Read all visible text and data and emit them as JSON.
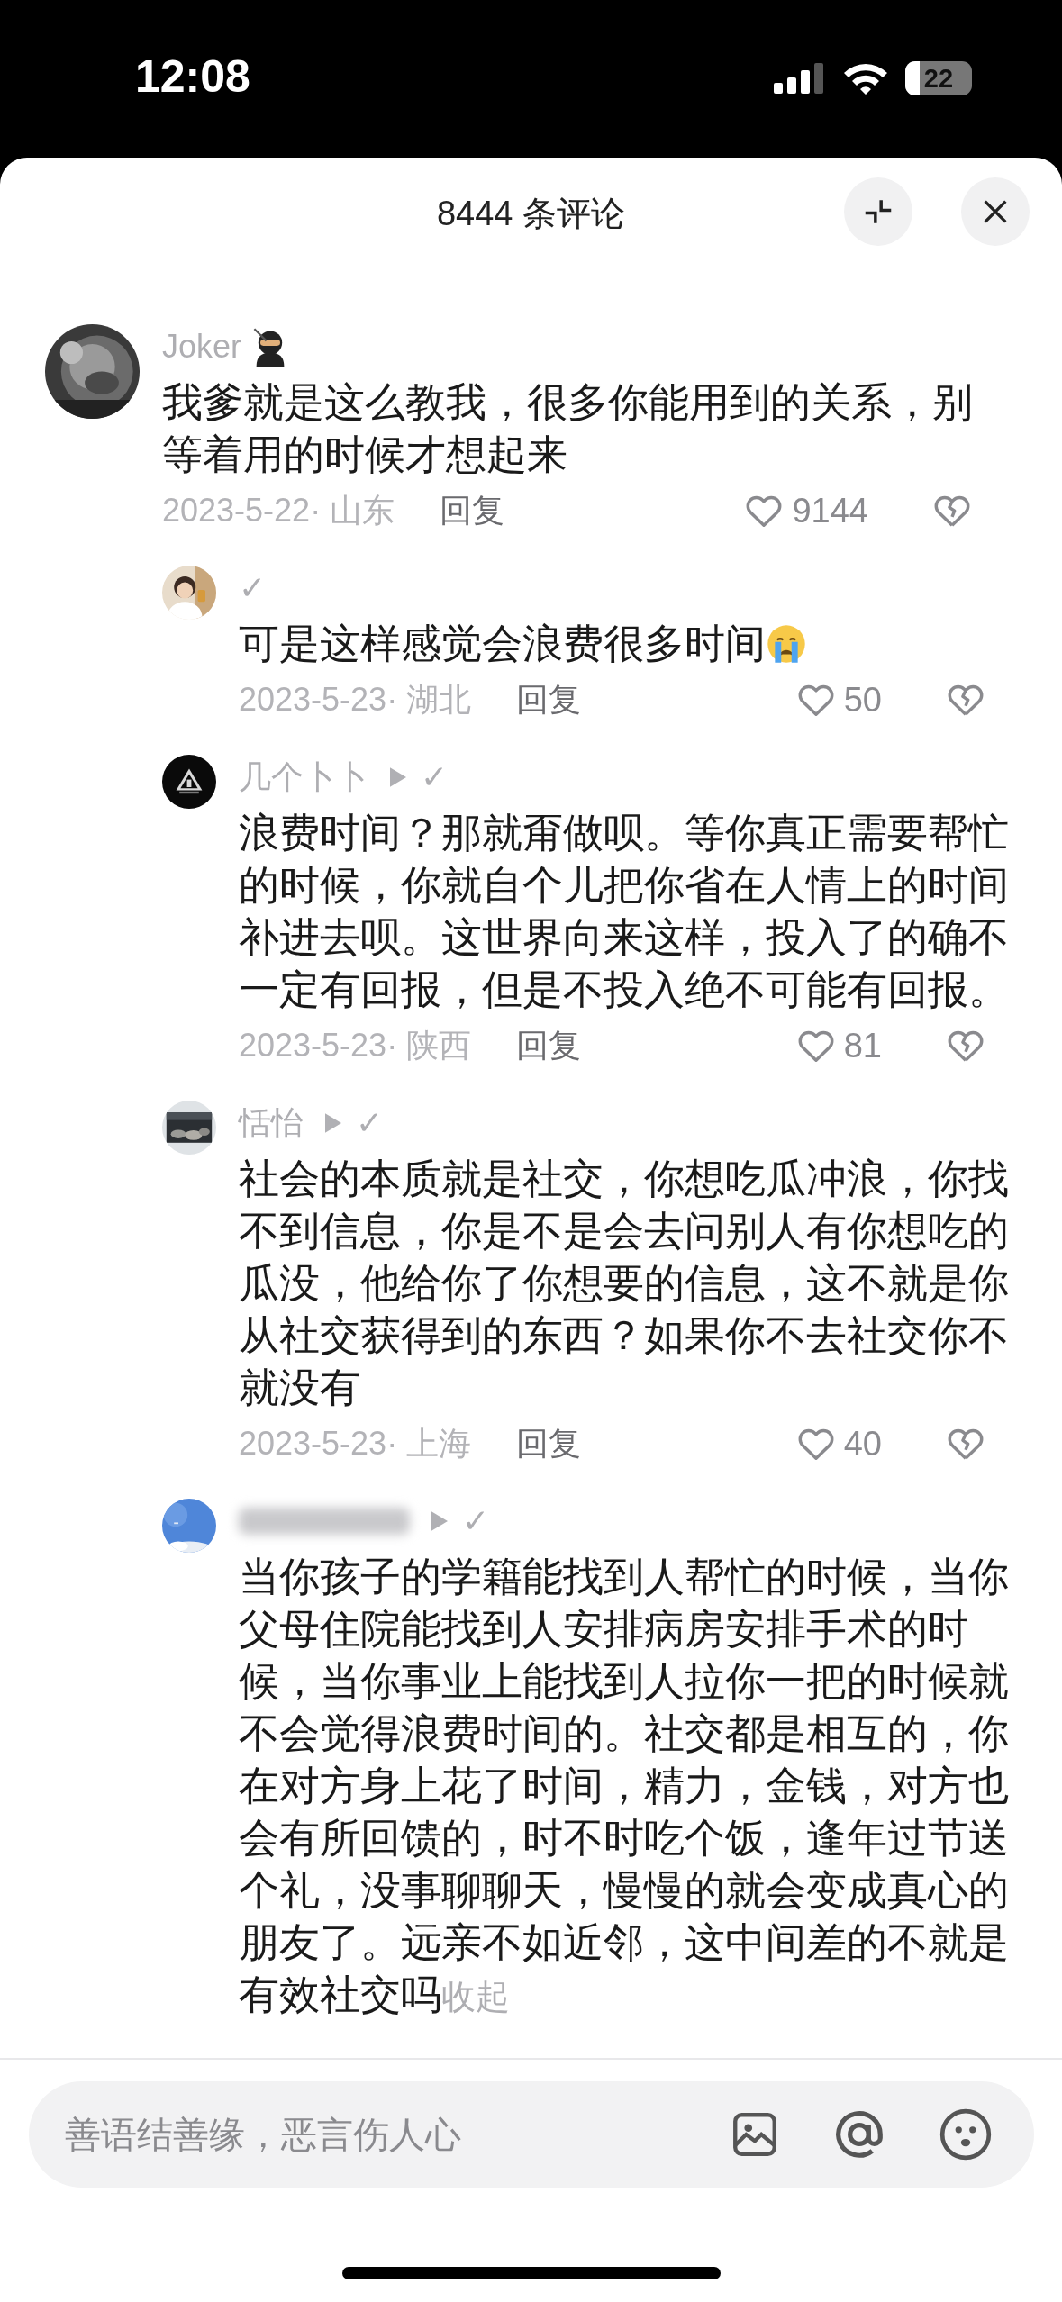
{
  "status_bar": {
    "time": "12:08",
    "battery": "22"
  },
  "header": {
    "title": "8444 条评论"
  },
  "comments": [
    {
      "author": "Joker",
      "author_blurred": false,
      "name_icon": {
        "kind": "ninja"
      },
      "text": "我爹就是这么教我，很多你能用到的关系，别等着用的时候才想起来",
      "date": "2023-5-22· 山东",
      "reply": "回复",
      "likes": "9144",
      "replies": [
        {
          "author": "✓",
          "author_blurred": false,
          "reply_arrow": false,
          "text": "可是这样感觉会浪费很多时间",
          "end_icon": {
            "kind": "crying"
          },
          "date": "2023-5-23· 湖北",
          "reply": "回复",
          "likes": "50"
        },
        {
          "author": "几个卜卜",
          "author_blurred": false,
          "reply_arrow": true,
          "reply_to": "✓",
          "text": "浪费时间？那就甭做呗。等你真正需要帮忙的时候，你就自个儿把你省在人情上的时间补进去呗。这世界向来这样，投入了的确不一定有回报，但是不投入绝不可能有回报。",
          "date": "2023-5-23· 陕西",
          "reply": "回复",
          "likes": "81"
        },
        {
          "author": "恬怡",
          "author_blurred": false,
          "reply_arrow": true,
          "reply_to": "✓",
          "text": "社会的本质就是社交，你想吃瓜冲浪，你找不到信息，你是不是会去问别人有你想吃的瓜没，他给你了你想要的信息，这不就是你从社交获得到的东西？如果你不去社交你不就没有",
          "date": "2023-5-23· 上海",
          "reply": "回复",
          "likes": "40"
        },
        {
          "author_blurred": true,
          "reply_arrow": true,
          "reply_to": "✓",
          "text": "当你孩子的学籍能找到人帮忙的时候，当你父母住院能找到人安排病房安排手术的时候，当你事业上能找到人拉你一把的时候就不会觉得浪费时间的。社交都是相互的，你在对方身上花了时间，精力，金钱，对方也会有所回馈的，时不时吃个饭，逢年过节送个礼，没事聊聊天，慢慢的就会变成真心的朋友了。远亲不如近邻，这中间差的不就是有效社交吗",
          "collapse_link": "收起"
        }
      ]
    }
  ],
  "input": {
    "placeholder": "善语结善缘，恶言伤人心"
  }
}
